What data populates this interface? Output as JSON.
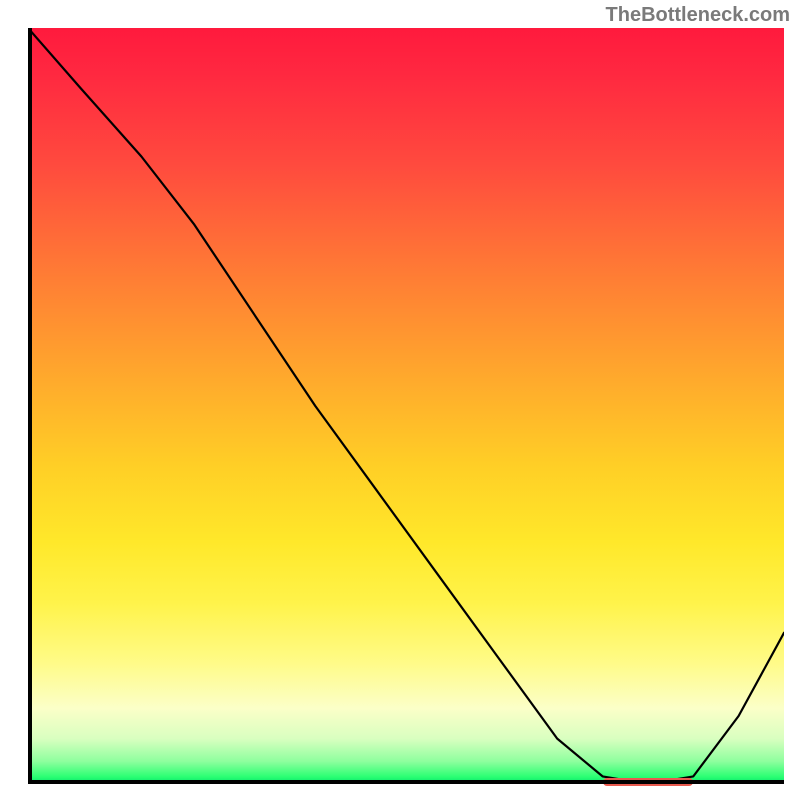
{
  "attribution": "TheBottleneck.com",
  "chart_data": {
    "type": "line",
    "title": "",
    "xlabel": "",
    "ylabel": "",
    "xlim": [
      0,
      100
    ],
    "ylim": [
      0,
      100
    ],
    "x": [
      0,
      7,
      15,
      22,
      30,
      38,
      46,
      54,
      62,
      70,
      76,
      82,
      88,
      94,
      100
    ],
    "values": [
      100,
      92,
      83,
      74,
      62,
      50,
      39,
      28,
      17,
      6,
      1,
      0,
      1,
      9,
      20
    ],
    "background_gradient": {
      "top": "#ff1a3d",
      "upper_mid": "#ffa52d",
      "mid": "#ffe82a",
      "lower_mid": "#fbffc8",
      "bottom": "#00e56a"
    },
    "marker": {
      "x_start": 76,
      "x_end": 88,
      "y": 0,
      "color": "#e85a4f"
    }
  }
}
